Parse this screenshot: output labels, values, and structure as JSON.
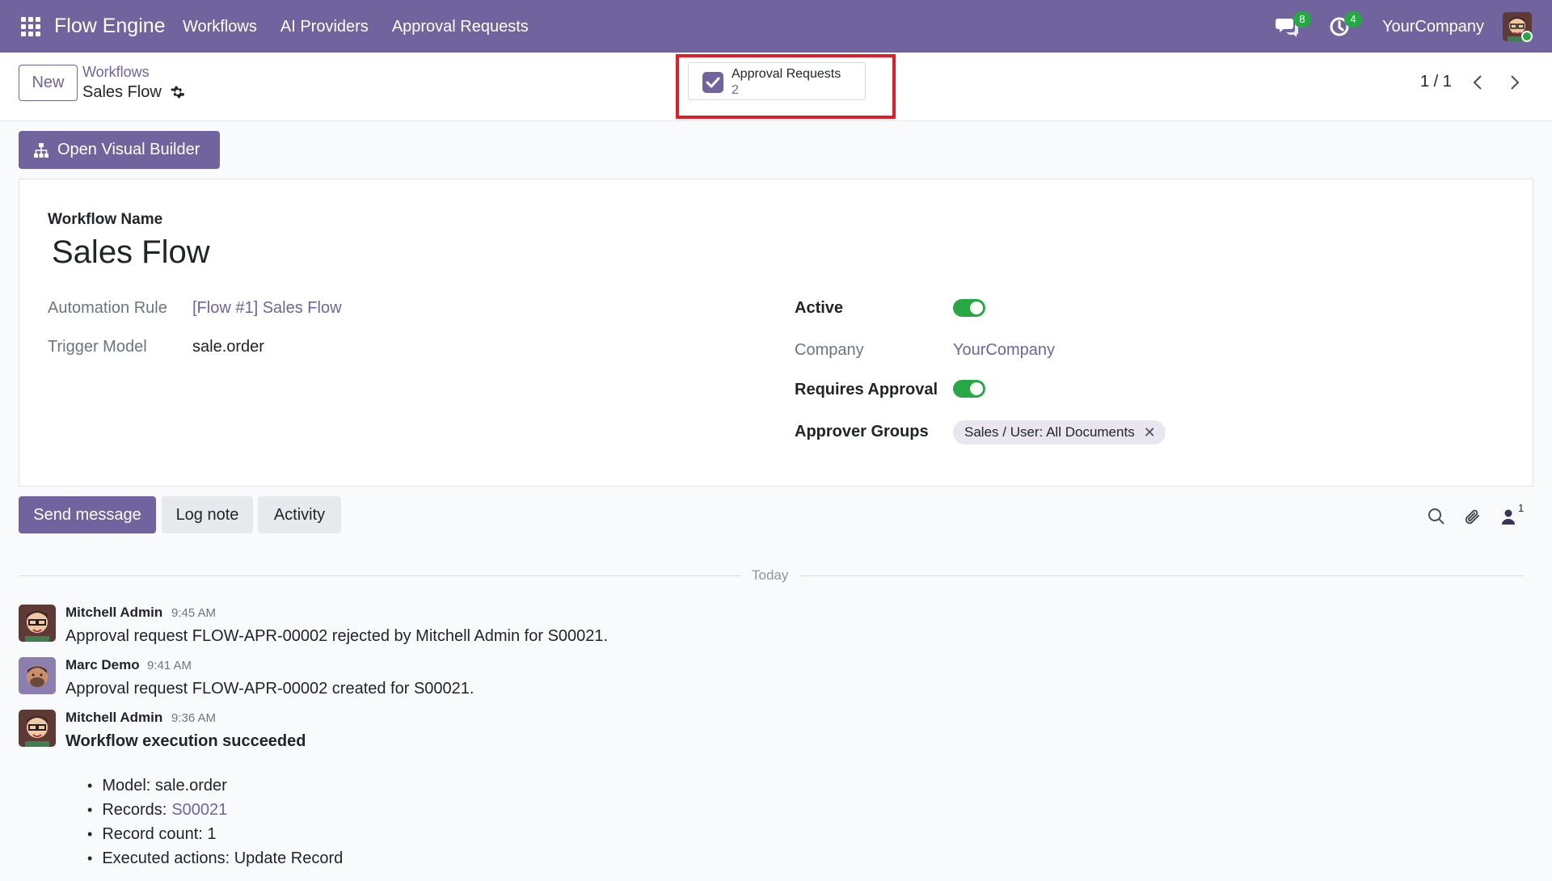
{
  "navbar": {
    "app_name": "Flow Engine",
    "menu": [
      "Workflows",
      "AI Providers",
      "Approval Requests"
    ],
    "messages_count": "8",
    "activities_count": "4",
    "company": "YourCompany",
    "color": "#71639e"
  },
  "control_panel": {
    "new_label": "New",
    "breadcrumb_parent": "Workflows",
    "breadcrumb_current": "Sales Flow",
    "smart_button": {
      "label": "Approval Requests",
      "count": "2"
    },
    "pager": "1 / 1"
  },
  "form": {
    "visual_builder_label": "Open Visual Builder",
    "name_label": "Workflow Name",
    "name_value": "Sales Flow",
    "automation_rule_label": "Automation Rule",
    "automation_rule_value": "[Flow #1] Sales Flow",
    "trigger_model_label": "Trigger Model",
    "trigger_model_value": "sale.order",
    "active_label": "Active",
    "active_value": true,
    "company_label": "Company",
    "company_value": "YourCompany",
    "requires_approval_label": "Requires Approval",
    "requires_approval_value": true,
    "approver_groups_label": "Approver Groups",
    "approver_groups": [
      "Sales / User: All Documents"
    ]
  },
  "chatter": {
    "send_message": "Send message",
    "log_note": "Log note",
    "activity": "Activity",
    "followers_count": "1",
    "date_separator": "Today",
    "messages": [
      {
        "author": "Mitchell Admin",
        "time": "9:45 AM",
        "body": "Approval request FLOW-APR-00002 rejected by Mitchell Admin for S00021."
      },
      {
        "author": "Marc Demo",
        "time": "9:41 AM",
        "body": "Approval request FLOW-APR-00002 created for S00021."
      },
      {
        "author": "Mitchell Admin",
        "time": "9:36 AM",
        "body": "Workflow execution succeeded",
        "details": {
          "model_label": "Model: sale.order",
          "records_label": "Records:",
          "records_value": "S00021",
          "count_label": "Record count: 1",
          "actions_label": "Executed actions: Update Record"
        }
      }
    ]
  }
}
